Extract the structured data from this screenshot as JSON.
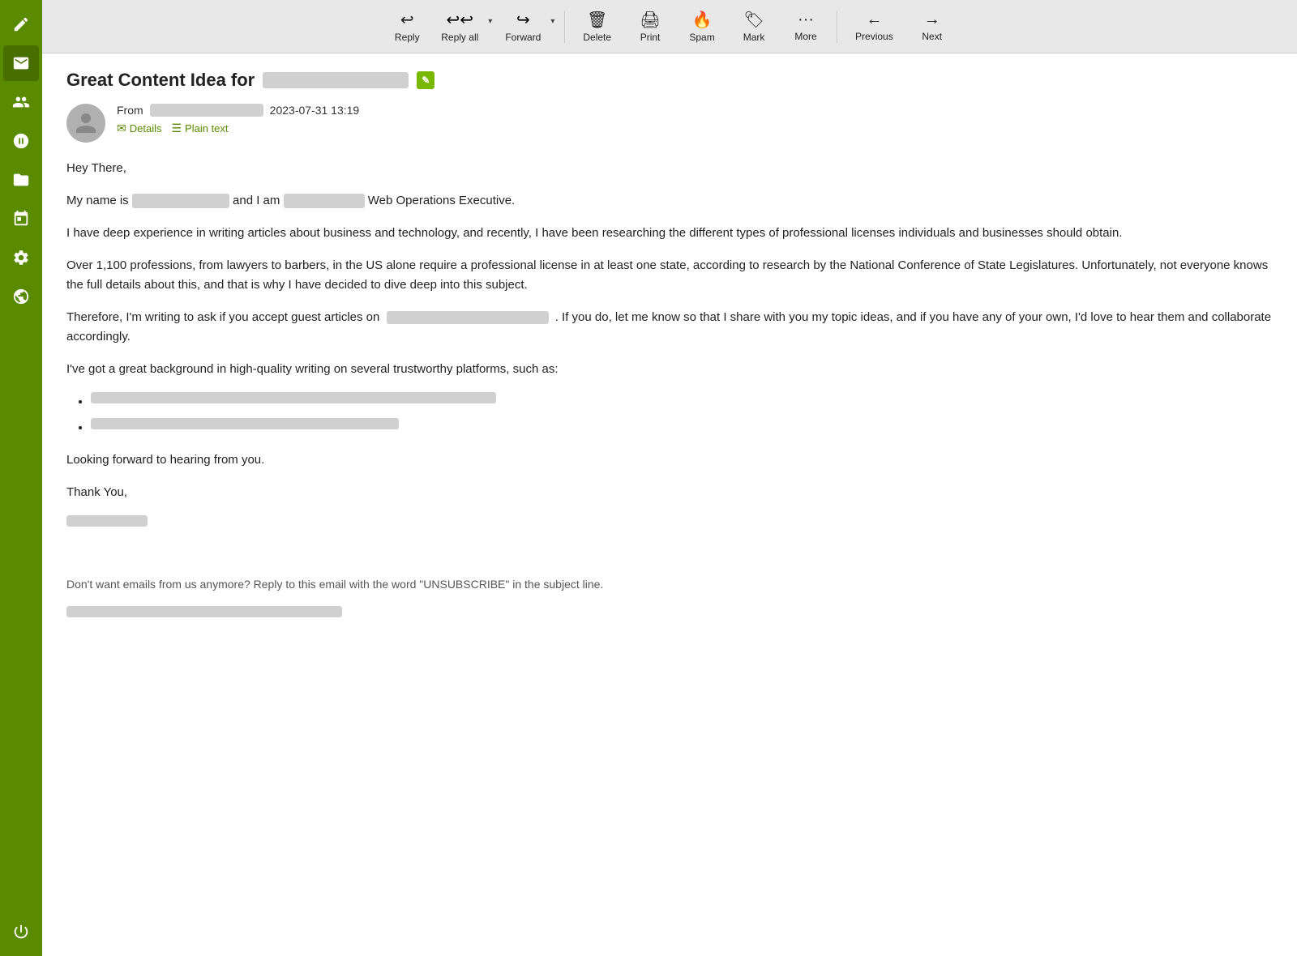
{
  "sidebar": {
    "items": [
      {
        "name": "compose",
        "label": "Compose"
      },
      {
        "name": "mail",
        "label": "Mail"
      },
      {
        "name": "contacts",
        "label": "Contacts"
      },
      {
        "name": "groups",
        "label": "Groups"
      },
      {
        "name": "files",
        "label": "Files"
      },
      {
        "name": "calendar",
        "label": "Calendar"
      },
      {
        "name": "settings",
        "label": "Settings"
      },
      {
        "name": "globe",
        "label": "Globe"
      },
      {
        "name": "power",
        "label": "Power"
      }
    ]
  },
  "toolbar": {
    "reply_label": "Reply",
    "reply_all_label": "Reply all",
    "forward_label": "Forward",
    "delete_label": "Delete",
    "print_label": "Print",
    "spam_label": "Spam",
    "mark_label": "Mark",
    "more_label": "More",
    "previous_label": "Previous",
    "next_label": "Next"
  },
  "email": {
    "subject_prefix": "Great Content Idea for",
    "from_label": "From",
    "date": "2023-07-31 13:19",
    "details_label": "Details",
    "plain_text_label": "Plain text",
    "body": {
      "greeting": "Hey There,",
      "intro": "My name is",
      "intro_suffix": "and I am",
      "role": "Web Operations Executive.",
      "para1": "I have deep experience in writing articles about business and technology, and recently, I have been researching the different types of professional licenses individuals and businesses should obtain.",
      "para2": "Over 1,100 professions, from lawyers to barbers, in the US alone require a professional license in at least one state, according to research by the National Conference of State Legislatures. Unfortunately, not everyone knows the full details about this, and that is why I have decided to dive deep into this subject.",
      "para3_prefix": "Therefore, I'm writing to ask if you accept guest articles on",
      "para3_suffix": ". If you do, let me know so that I share with you my topic ideas, and if you have any of your own, I'd love to hear them and collaborate accordingly.",
      "para4": "I've got a great background in high-quality writing on several trustworthy platforms, such as:",
      "closing": "Looking forward to hearing from you.",
      "sign_off": "Thank You,",
      "footer_note": "Don't want emails from us anymore? Reply to this email with the word \"UNSUBSCRIBE\" in the subject line."
    }
  }
}
